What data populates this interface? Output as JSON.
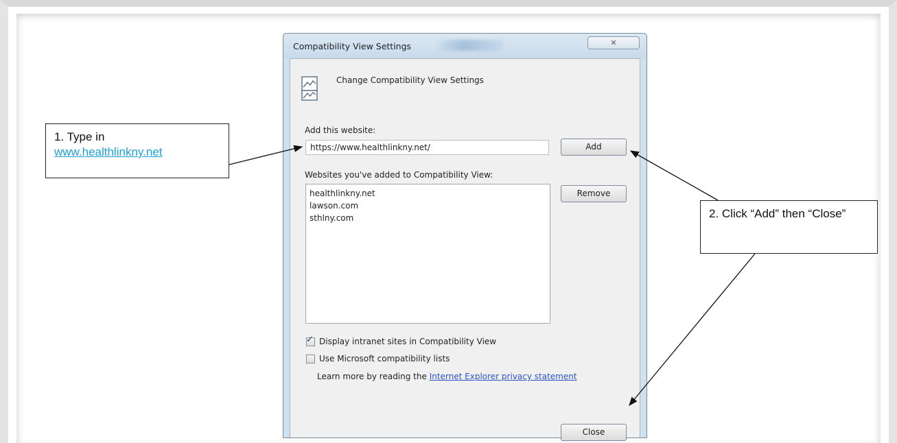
{
  "dialog": {
    "title": "Compatibility View Settings",
    "close_glyph": "✕",
    "header_text": "Change Compatibility View Settings",
    "add_label": "Add this website:",
    "url_value": "https://www.healthlinkny.net/",
    "add_button": "Add",
    "sites_label": "Websites you've added to Compatibility View:",
    "sites": [
      "healthlinkny.net",
      "lawson.com",
      "sthlny.com"
    ],
    "remove_button": "Remove",
    "check_intranet": {
      "label": "Display intranet sites in Compatibility View",
      "checked": true
    },
    "check_ms_lists": {
      "label": "Use Microsoft compatibility lists",
      "checked": false
    },
    "learn_prefix": "Learn more by reading the ",
    "learn_link": "Internet Explorer privacy statement",
    "close_button": "Close"
  },
  "callouts": {
    "step1_text": "1. Type in",
    "step1_link": "www.healthlinkny.net",
    "step2_text": "2. Click “Add” then “Close”"
  },
  "colors": {
    "link": "#2a52c8",
    "callout_link": "#1aa1d6",
    "dialog_frame": "#cfe0ee"
  }
}
